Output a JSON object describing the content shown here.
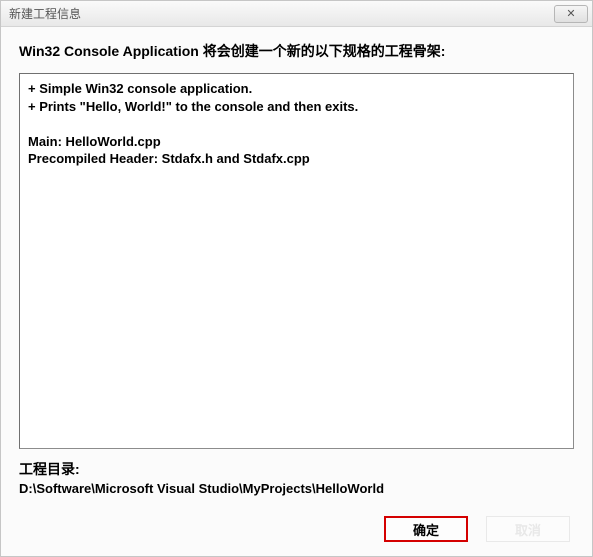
{
  "titlebar": {
    "title": "新建工程信息",
    "close_icon": "✕"
  },
  "heading": "Win32 Console Application 将会创建一个新的以下规格的工程骨架:",
  "description": "+ Simple Win32 console application.\n+ Prints \"Hello, World!\" to the console and then exits.\n\nMain: HelloWorld.cpp\nPrecompiled Header: Stdafx.h and Stdafx.cpp",
  "footer": {
    "label": "工程目录:",
    "path": "D:\\Software\\Microsoft Visual Studio\\MyProjects\\HelloWorld"
  },
  "buttons": {
    "ok": "确定",
    "cancel": "取消"
  }
}
